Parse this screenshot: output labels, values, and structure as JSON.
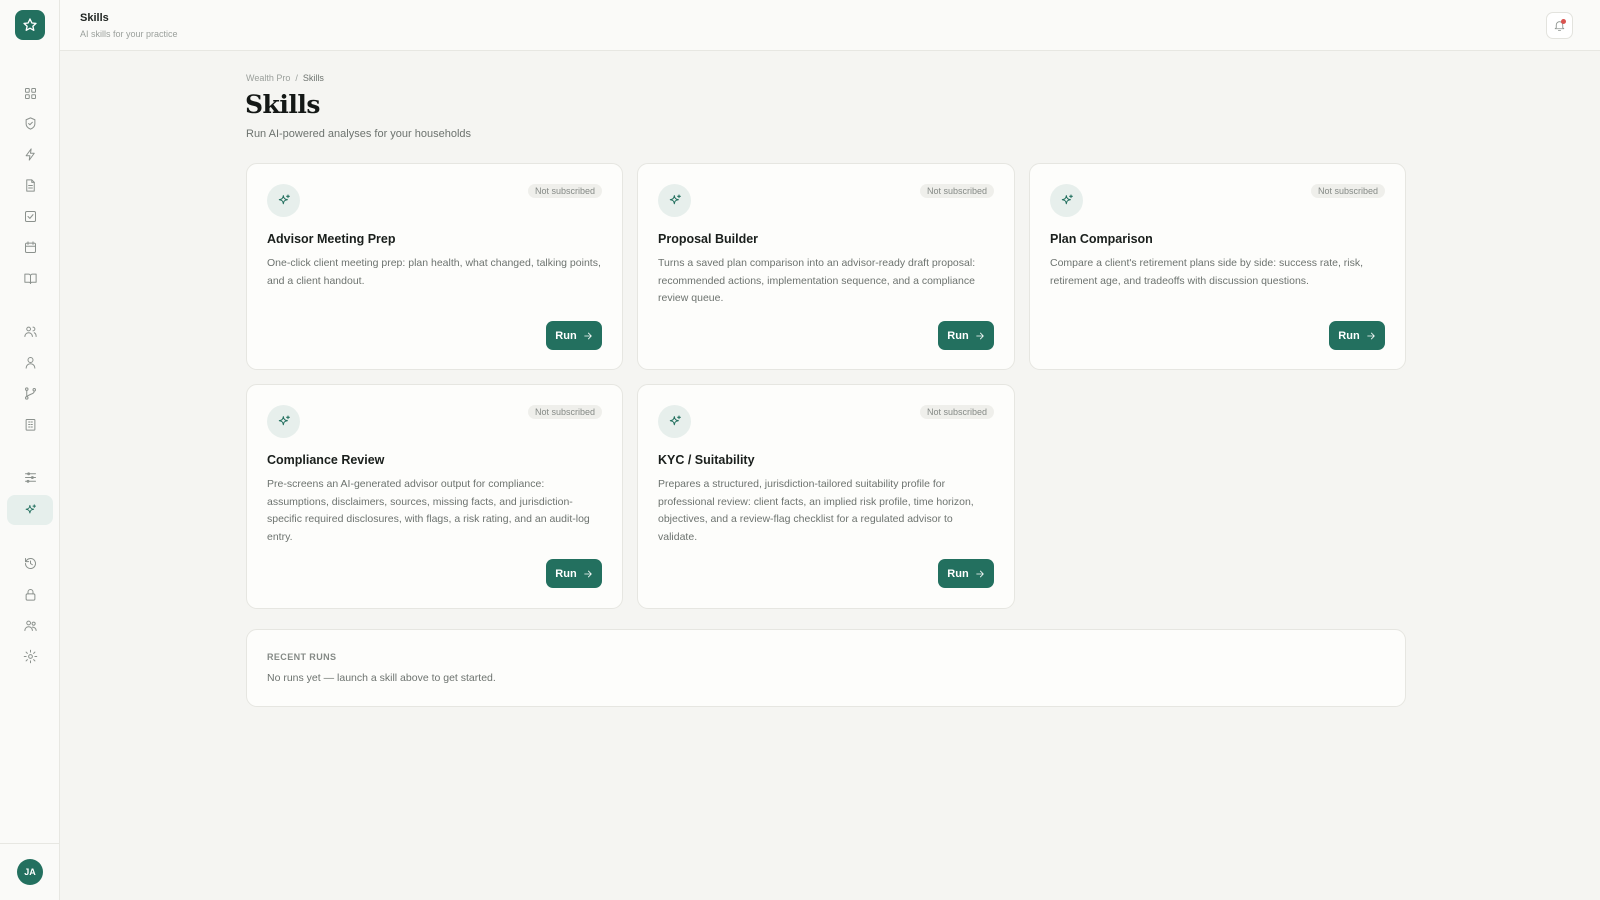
{
  "app": {
    "title": "Skills",
    "subtitle": "AI skills for your practice",
    "user_initials": "JA"
  },
  "sidebar": {
    "items": [
      {
        "name": "grid-icon",
        "active": false
      },
      {
        "name": "shield-icon",
        "active": false
      },
      {
        "name": "lightning-icon",
        "active": false
      },
      {
        "name": "document-icon",
        "active": false
      },
      {
        "name": "checkbox-icon",
        "active": false
      },
      {
        "name": "calendar-icon",
        "active": false
      },
      {
        "name": "book-icon",
        "active": false
      },
      {
        "name": "users-icon",
        "active": false
      },
      {
        "name": "user-icon",
        "active": false
      },
      {
        "name": "branch-icon",
        "active": false
      },
      {
        "name": "building-icon",
        "active": false
      },
      {
        "name": "sliders-icon",
        "active": false
      },
      {
        "name": "sparkles-icon",
        "active": true
      },
      {
        "name": "history-icon",
        "active": false
      },
      {
        "name": "lock-icon",
        "active": false
      },
      {
        "name": "team-icon",
        "active": false
      },
      {
        "name": "settings-icon",
        "active": false
      }
    ]
  },
  "breadcrumb": {
    "root": "Wealth Pro",
    "separator": "/",
    "current": "Skills"
  },
  "header": {
    "title": "Skills",
    "subtitle": "Run AI-powered analyses for your households"
  },
  "skills": [
    {
      "title": "Advisor Meeting Prep",
      "status": "Not subscribed",
      "description": "One-click client meeting prep: plan health, what changed, talking points, and a client handout.",
      "button": "Run"
    },
    {
      "title": "Proposal Builder",
      "status": "Not subscribed",
      "description": "Turns a saved plan comparison into an advisor-ready draft proposal: recommended actions, implementation sequence, and a compliance review queue.",
      "button": "Run"
    },
    {
      "title": "Plan Comparison",
      "status": "Not subscribed",
      "description": "Compare a client's retirement plans side by side: success rate, risk, retirement age, and tradeoffs with discussion questions.",
      "button": "Run"
    },
    {
      "title": "Compliance Review",
      "status": "Not subscribed",
      "description": "Pre-screens an AI-generated advisor output for compliance: assumptions, disclaimers, sources, missing facts, and jurisdiction-specific required disclosures, with flags, a risk rating, and an audit-log entry.",
      "button": "Run"
    },
    {
      "title": "KYC / Suitability",
      "status": "Not subscribed",
      "description": "Prepares a structured, jurisdiction-tailored suitability profile for professional review: client facts, an implied risk profile, time horizon, objectives, and a review-flag checklist for a regulated advisor to validate.",
      "button": "Run"
    }
  ],
  "recent_runs": {
    "label": "RECENT RUNS",
    "empty_text": "No runs yet — launch a skill above to get started."
  },
  "colors": {
    "accent": "#23705f",
    "background": "#f5f5f2",
    "notification_dot": "#d9534f"
  }
}
